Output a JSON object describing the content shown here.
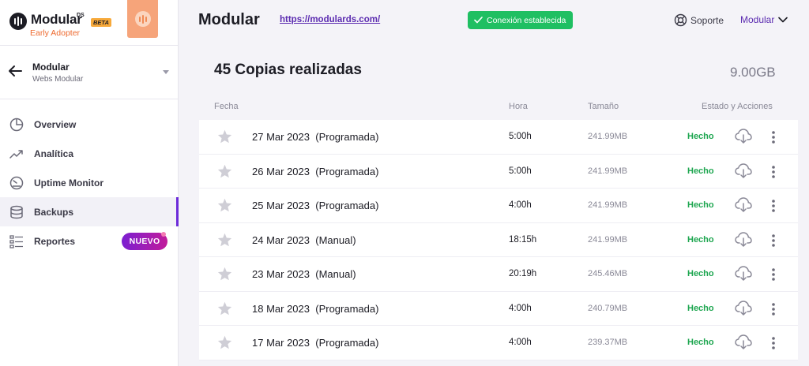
{
  "brand": {
    "name": "Modular",
    "suffix": "DS",
    "badge": "BETA",
    "tagline": "Early Adopter"
  },
  "site": {
    "name": "Modular",
    "subtitle": "Webs Modular"
  },
  "nav": [
    {
      "label": "Overview"
    },
    {
      "label": "Analítica"
    },
    {
      "label": "Uptime Monitor"
    },
    {
      "label": "Backups",
      "active": true
    },
    {
      "label": "Reportes",
      "badge": "NUEVO"
    }
  ],
  "header": {
    "title": "Modular",
    "url": "https://modulards.com/",
    "connection": "Conexión establecida",
    "support": "Soporte",
    "user": "Modular"
  },
  "summary": {
    "title": "45 Copias realizadas",
    "total_size": "9.00GB"
  },
  "columns": {
    "date": "Fecha",
    "hour": "Hora",
    "size": "Tamaño",
    "actions": "Estado y Acciones"
  },
  "backups": [
    {
      "date": "27 Mar 2023",
      "type": "(Programada)",
      "hour": "5:00h",
      "size": "241.99MB",
      "status": "Hecho"
    },
    {
      "date": "26 Mar 2023",
      "type": "(Programada)",
      "hour": "5:00h",
      "size": "241.99MB",
      "status": "Hecho"
    },
    {
      "date": "25 Mar 2023",
      "type": "(Programada)",
      "hour": "4:00h",
      "size": "241.99MB",
      "status": "Hecho"
    },
    {
      "date": "24 Mar 2023",
      "type": "(Manual)",
      "hour": "18:15h",
      "size": "241.99MB",
      "status": "Hecho"
    },
    {
      "date": "23 Mar 2023",
      "type": "(Manual)",
      "hour": "20:19h",
      "size": "245.46MB",
      "status": "Hecho"
    },
    {
      "date": "18 Mar 2023",
      "type": "(Programada)",
      "hour": "4:00h",
      "size": "240.79MB",
      "status": "Hecho"
    },
    {
      "date": "17 Mar 2023",
      "type": "(Programada)",
      "hour": "4:00h",
      "size": "239.37MB",
      "status": "Hecho"
    }
  ],
  "colors": {
    "accent": "#6c2bd9",
    "success": "#1fbf62",
    "status_done": "#1ea650",
    "brand_orange": "#ee6a2f"
  }
}
